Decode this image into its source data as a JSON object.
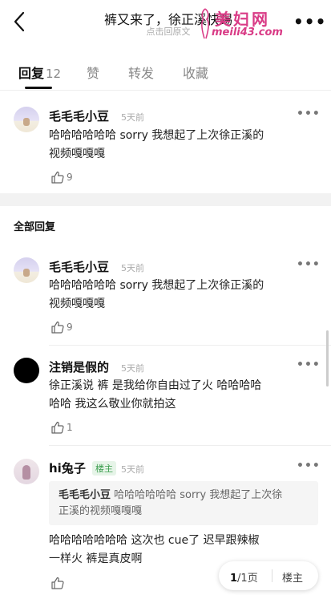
{
  "header": {
    "back_icon": "chevron-left-icon",
    "title": "裤又来了，徐正溪快踢",
    "subtitle": "点击回原文",
    "more_icon": "more-horizontal-icon",
    "watermark_line1": "美妇网",
    "watermark_line2": "meili43.com"
  },
  "tabs": [
    {
      "label": "回复",
      "count": "12",
      "active": true
    },
    {
      "label": "赞",
      "count": "",
      "active": false
    },
    {
      "label": "转发",
      "count": "",
      "active": false
    },
    {
      "label": "收藏",
      "count": "",
      "active": false
    }
  ],
  "top_comment": {
    "user": "毛毛毛小豆",
    "time": "5天前",
    "text_line1": "哈哈哈哈哈哈 sorry 我想起了上次徐正溪的",
    "text_line2": "视频嘎嘎嘎",
    "likes": "9"
  },
  "section_label": "全部回复",
  "replies": [
    {
      "user": "毛毛毛小豆",
      "time": "5天前",
      "text_line1": "哈哈哈哈哈哈 sorry 我想起了上次徐正溪的",
      "text_line2": "视频嘎嘎嘎",
      "likes": "9"
    },
    {
      "user": "注销是假的",
      "time": "5天前",
      "text_line1": "徐正溪说 裤 是我给你自由过了火  哈哈哈哈",
      "text_line2": "哈哈 我这么敬业你就拍这",
      "likes": "1"
    },
    {
      "user": "hi兔子",
      "badge": "楼主",
      "time": "5天前",
      "quote_user": "毛毛毛小豆",
      "quote_line1": "哈哈哈哈哈哈 sorry 我想起了上次徐",
      "quote_line2": "正溪的视频嘎嘎嘎",
      "text_line1": "哈哈哈哈哈哈哈 这次也 cue了  迟早跟辣椒",
      "text_line2": "一样火 裤是真皮啊"
    }
  ],
  "pager": {
    "current": "1",
    "total_text": "/1页",
    "host_only": "楼主"
  },
  "colors": {
    "badge_green": "#3a9d4d",
    "watermark_pink": "#d93b86"
  }
}
